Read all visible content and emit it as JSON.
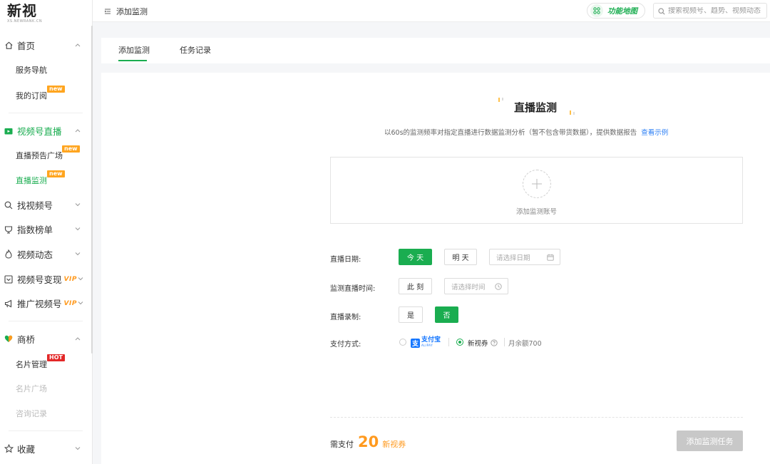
{
  "brand": {
    "logo_text": "新视",
    "logo_sub": "XS.NEWRANK.CN"
  },
  "sidebar": {
    "groups": [
      {
        "label": "首页",
        "icon": "home-icon"
      },
      {
        "label": "视频号直播",
        "icon": "live-tv-icon"
      },
      {
        "label": "找视频号",
        "icon": "search-icon"
      },
      {
        "label": "指数榜单",
        "icon": "trophy-icon"
      },
      {
        "label": "视频动态",
        "icon": "flame-icon"
      },
      {
        "label": "视频号变现",
        "icon": "monetize-icon",
        "vip": "VIP"
      },
      {
        "label": "推广视频号",
        "icon": "megaphone-icon",
        "vip": "VIP"
      },
      {
        "label": "商桥",
        "icon": "heart-icon"
      },
      {
        "label": "收藏",
        "icon": "star-icon"
      }
    ],
    "sub_items": {
      "service_nav": "服务导航",
      "my_subscription": "我的订阅",
      "live_preview": "直播预告广场",
      "live_monitor": "直播监测",
      "card_manage": "名片管理",
      "card_plaza": "名片广场",
      "consult_records": "咨询记录"
    },
    "badges": {
      "new": "new",
      "hot": "HOT"
    }
  },
  "topbar": {
    "breadcrumb": "添加监测",
    "function_map": "功能地图",
    "search_placeholder": "搜索视频号、趋势、视频动态"
  },
  "tabs": [
    {
      "label": "添加监测",
      "active": true
    },
    {
      "label": "任务记录",
      "active": false
    }
  ],
  "main": {
    "title": "直播监测",
    "subtitle": "以60s的监测频率对指定直播进行数据监测分析（暂不包含带货数据），提供数据报告",
    "example_link": "查看示例",
    "add_account_label": "添加监测账号",
    "form": {
      "date_label": "直播日期:",
      "today": "今 天",
      "tomorrow": "明 天",
      "date_placeholder": "请选择日期",
      "time_label": "监测直播时间:",
      "now": "此 刻",
      "time_placeholder": "请选择时间",
      "record_label": "直播录制:",
      "yes": "是",
      "no": "否",
      "pay_label": "支付方式:",
      "alipay_cn": "支付宝",
      "alipay_en": "ALIPAY",
      "coupon": "新视券",
      "balance": "月余额700"
    },
    "pay": {
      "label": "需支付",
      "amount": "20",
      "unit": "新视券"
    },
    "submit": "添加监测任务"
  },
  "colors": {
    "accent": "#1aad50",
    "orange": "#ff9a1f",
    "link": "#2a7ef5",
    "badge_new": "#ffa51f",
    "badge_hot": "#e32828"
  }
}
